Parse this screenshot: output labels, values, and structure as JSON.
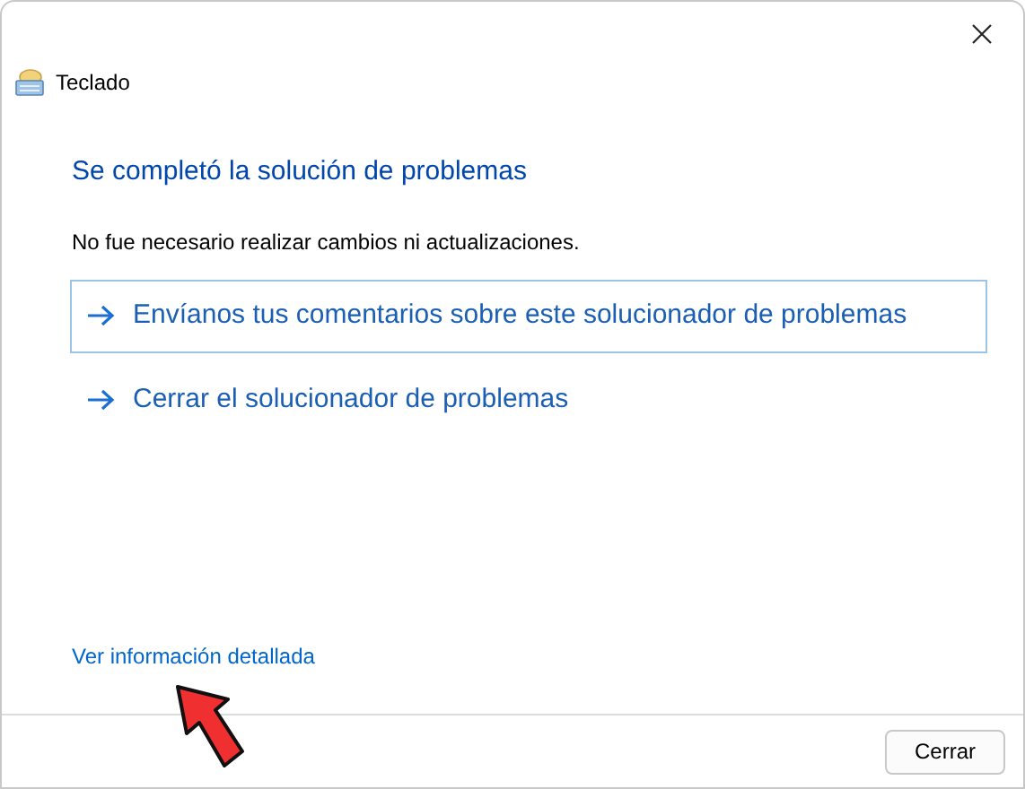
{
  "window": {
    "title": "Teclado"
  },
  "heading": "Se completó la solución de problemas",
  "message": "No fue necesario realizar cambios ni actualizaciones.",
  "options": [
    {
      "label": "Envíanos tus comentarios sobre este solucionador de problemas",
      "selected": true
    },
    {
      "label": "Cerrar el solucionador de problemas",
      "selected": false
    }
  ],
  "details_link": "Ver información detallada",
  "buttons": [
    "Cerrar"
  ]
}
